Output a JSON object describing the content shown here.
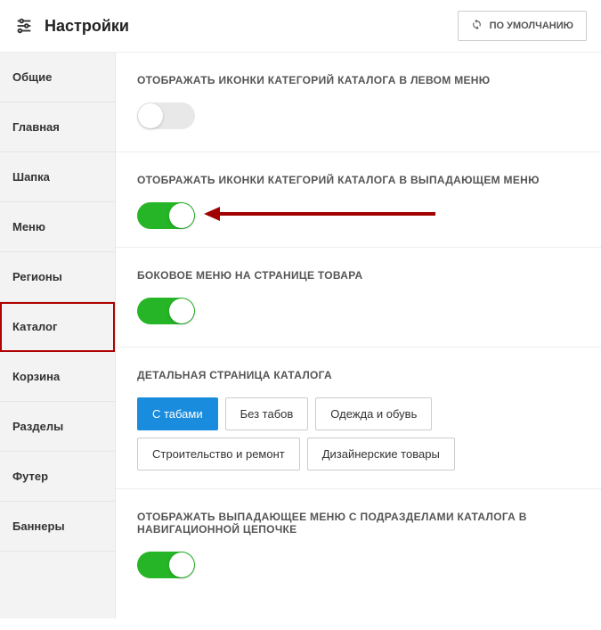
{
  "header": {
    "title": "Настройки",
    "defaultButton": "ПО УМОЛЧАНИЮ"
  },
  "sidebar": {
    "items": [
      {
        "label": "Общие",
        "active": false
      },
      {
        "label": "Главная",
        "active": false
      },
      {
        "label": "Шапка",
        "active": false
      },
      {
        "label": "Меню",
        "active": false
      },
      {
        "label": "Регионы",
        "active": false
      },
      {
        "label": "Каталог",
        "active": true
      },
      {
        "label": "Корзина",
        "active": false
      },
      {
        "label": "Разделы",
        "active": false
      },
      {
        "label": "Футер",
        "active": false
      },
      {
        "label": "Баннеры",
        "active": false
      }
    ]
  },
  "sections": {
    "iconsLeftMenu": {
      "title": "ОТОБРАЖАТЬ ИКОНКИ КАТЕГОРИЙ КАТАЛОГА В ЛЕВОМ МЕНЮ",
      "enabled": false
    },
    "iconsDropdown": {
      "title": "ОТОБРАЖАТЬ ИКОНКИ КАТЕГОРИЙ КАТАЛОГА В ВЫПАДАЮЩЕМ МЕНЮ",
      "enabled": true
    },
    "sideMenuProduct": {
      "title": "БОКОВОЕ МЕНЮ НА СТРАНИЦЕ ТОВАРА",
      "enabled": true
    },
    "detailPage": {
      "title": "ДЕТАЛЬНАЯ СТРАНИЦА КАТАЛОГА",
      "options": [
        {
          "label": "С табами",
          "active": true
        },
        {
          "label": "Без табов",
          "active": false
        },
        {
          "label": "Одежда и обувь",
          "active": false
        },
        {
          "label": "Строительство и ремонт",
          "active": false
        },
        {
          "label": "Дизайнерские товары",
          "active": false
        }
      ]
    },
    "breadcrumbDropdown": {
      "title": "ОТОБРАЖАТЬ ВЫПАДАЮЩЕЕ МЕНЮ С ПОДРАЗДЕЛАМИ КАТАЛОГА В НАВИГАЦИОННОЙ ЦЕПОЧКЕ",
      "enabled": true
    }
  }
}
